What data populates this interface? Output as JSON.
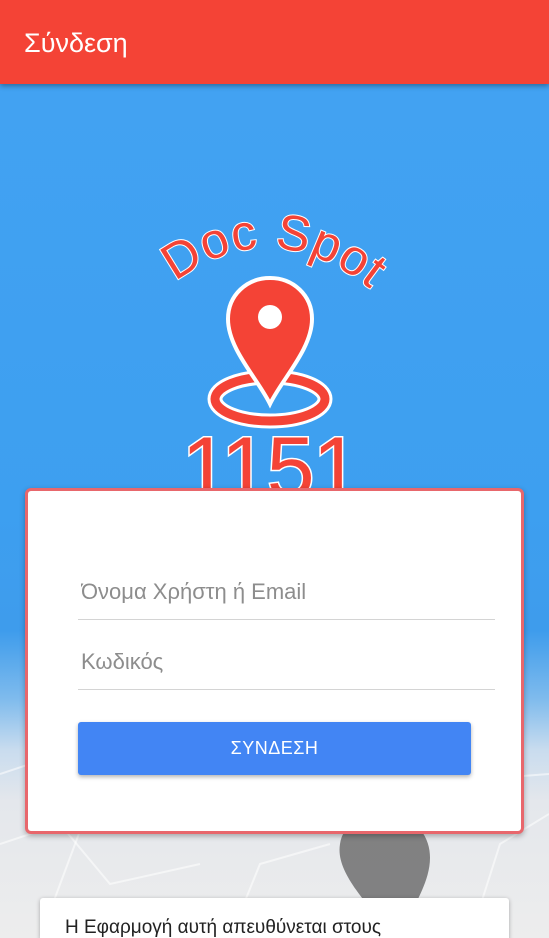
{
  "app_bar": {
    "title": "Σύνδεση"
  },
  "logo": {
    "top_text": "Doc Spot",
    "number": "1151",
    "color": "#f44336"
  },
  "login_form": {
    "username_placeholder": "Όνομα Χρήστη ή Email",
    "username_value": "",
    "password_placeholder": "Κωδικός",
    "password_value": "",
    "submit_label": "ΣΥΝΔΕΣΗ"
  },
  "info_card": {
    "text": "Η Εφαρμογή αυτή απευθύνεται στους"
  },
  "colors": {
    "app_bar": "#f44336",
    "background": "#42a0f0",
    "card_border": "#e8676c",
    "button": "#4285f4"
  }
}
